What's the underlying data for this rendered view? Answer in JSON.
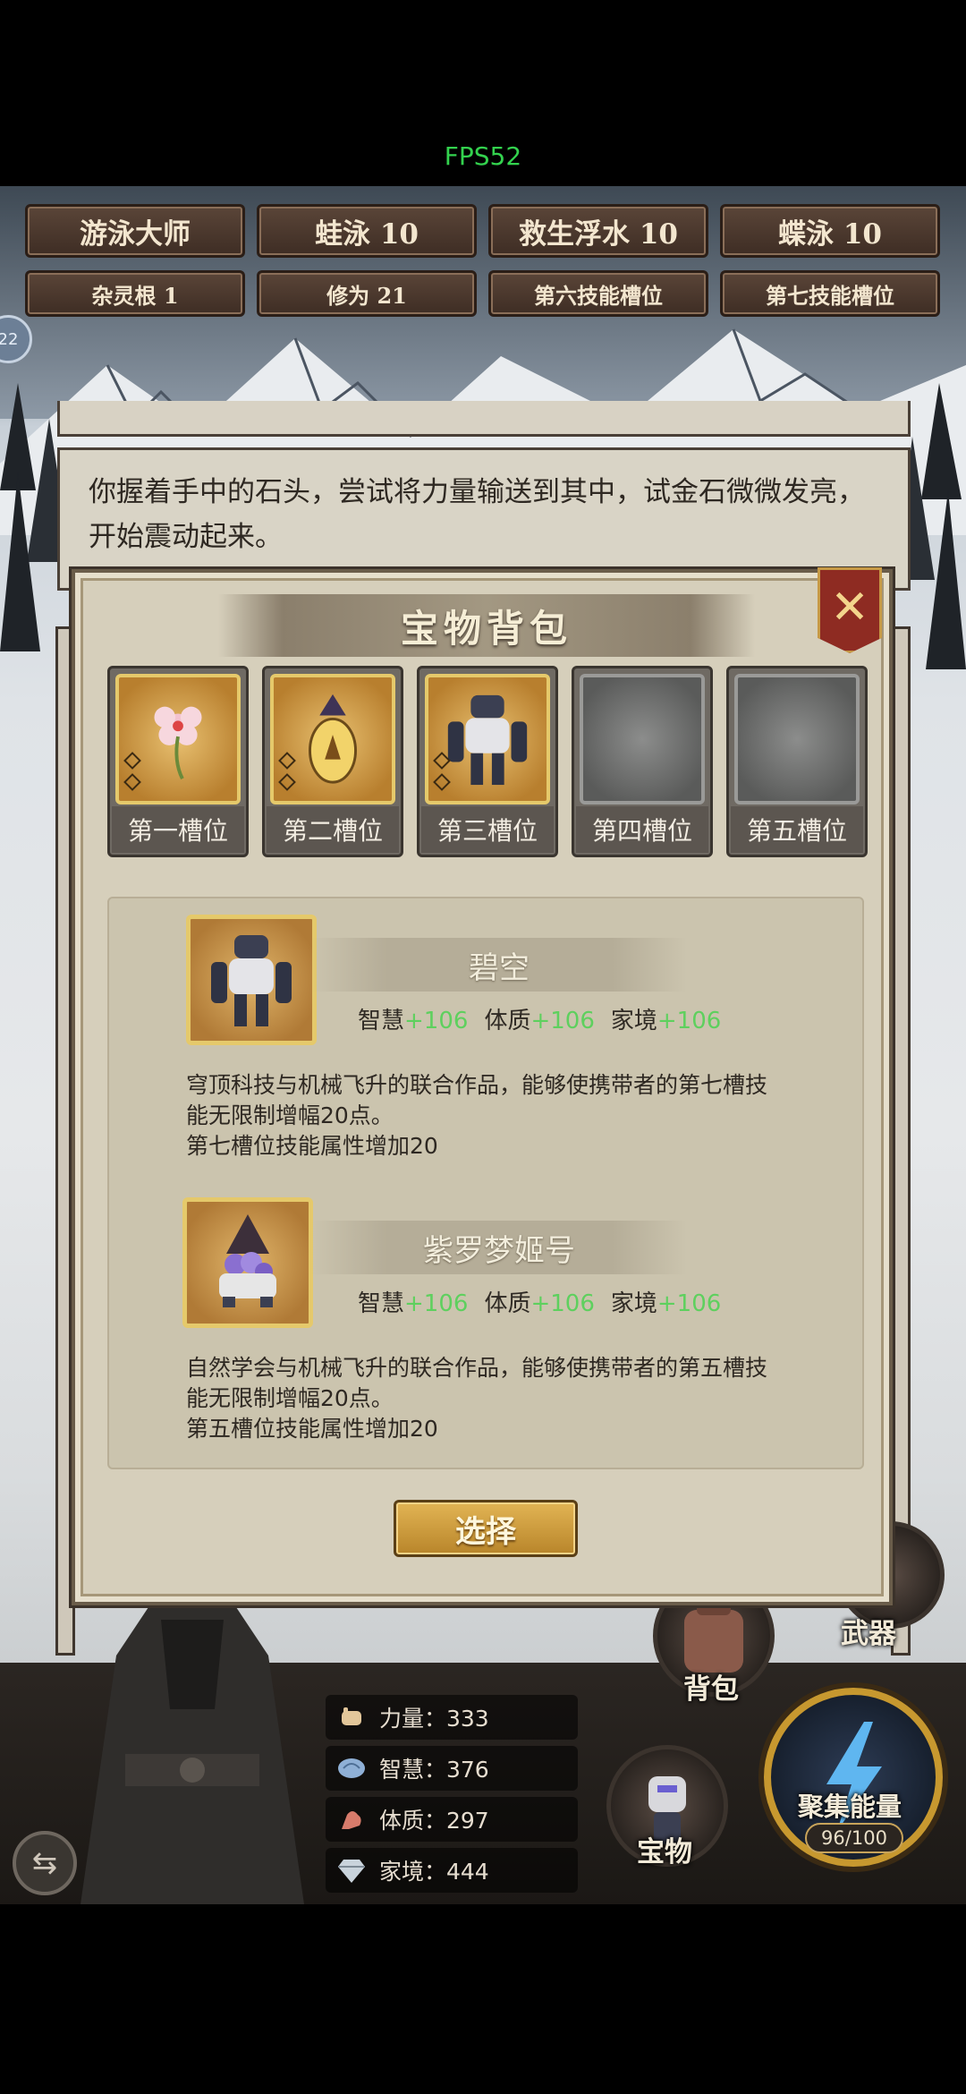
{
  "status": {
    "fps": "FPS52"
  },
  "tags": {
    "row1": [
      "游泳大师",
      "蛙泳 10",
      "救生浮水 10",
      "蝶泳 10"
    ],
    "row2": [
      "杂灵根 1",
      "修为 21",
      "第六技能槽位",
      "第七技能槽位"
    ]
  },
  "side_badge": "22",
  "story": {
    "text": "你握着手中的石头，尝试将力量输送到其中，试金石微微发亮，开始震动起来。"
  },
  "modal": {
    "title": "宝物背包",
    "close_icon": "close-x-icon",
    "slots": [
      {
        "label": "第一槽位",
        "filled": true,
        "icon": "flower-icon"
      },
      {
        "label": "第二槽位",
        "filled": true,
        "icon": "gem-pendant-icon"
      },
      {
        "label": "第三槽位",
        "filled": true,
        "icon": "mech-robot-icon"
      },
      {
        "label": "第四槽位",
        "filled": false
      },
      {
        "label": "第五槽位",
        "filled": false
      }
    ],
    "items": [
      {
        "name": "碧空",
        "icon": "mech-robot-icon",
        "attrs": [
          {
            "label": "智慧",
            "value": "+106"
          },
          {
            "label": "体质",
            "value": "+106"
          },
          {
            "label": "家境",
            "value": "+106"
          }
        ],
        "desc1": "穹顶科技与机械飞升的联合作品，能够使携带者的第七槽技",
        "desc2": "能无限制增幅20点。",
        "desc3": "第七槽位技能属性增加20"
      },
      {
        "name": "紫罗梦姬号",
        "icon": "flower-pot-mech-icon",
        "attrs": [
          {
            "label": "智慧",
            "value": "+106"
          },
          {
            "label": "体质",
            "value": "+106"
          },
          {
            "label": "家境",
            "value": "+106"
          }
        ],
        "desc1": "自然学会与机械飞升的联合作品，能够使携带者的第五槽技",
        "desc2": "能无限制增幅20点。",
        "desc3": "第五槽位技能属性增加20"
      }
    ],
    "select_label": "选择"
  },
  "hud": {
    "stats": [
      {
        "label": "力量：333",
        "icon": "fist-icon"
      },
      {
        "label": "智慧：376",
        "icon": "brain-icon"
      },
      {
        "label": "体质：297",
        "icon": "muscle-arm-icon"
      },
      {
        "label": "家境：444",
        "icon": "diamond-icon"
      }
    ],
    "weapon_label": "武器",
    "bag_label": "背包",
    "treasure_label": "宝物",
    "energy_label": "聚集能量",
    "energy_count": "96/100"
  },
  "colors": {
    "fps_green": "#33d24e",
    "attr_green": "#5ed05e",
    "gold": "#e5c96b",
    "close_red": "#8e2b22"
  }
}
